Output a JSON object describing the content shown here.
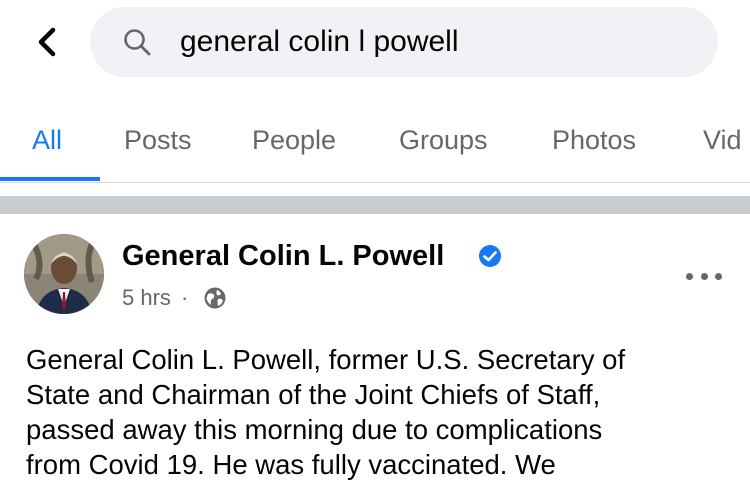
{
  "search": {
    "query": "general colin l powell"
  },
  "tabs": [
    {
      "label": "All",
      "active": true
    },
    {
      "label": "Posts",
      "active": false
    },
    {
      "label": "People",
      "active": false
    },
    {
      "label": "Groups",
      "active": false
    },
    {
      "label": "Photos",
      "active": false
    },
    {
      "label": "Vid",
      "active": false
    }
  ],
  "post": {
    "author": "General Colin L. Powell",
    "verified": true,
    "time": "5 hrs",
    "separator": "·",
    "audience_icon": "globe-icon",
    "body_lines": [
      "General Colin L. Powell, former U.S. Secretary of",
      "State and Chairman of the Joint Chiefs of Staff,",
      "passed away this morning due to complications",
      "from Covid 19.  He was fully vaccinated.  We"
    ]
  },
  "colors": {
    "accent": "#1877f2",
    "secondary_text": "#65676b",
    "search_bg": "#f0f2f5",
    "section_gap": "#c9ccd1"
  },
  "icons": [
    "back-arrow-icon",
    "search-icon",
    "verified-badge-icon",
    "globe-icon",
    "more-options-icon"
  ]
}
